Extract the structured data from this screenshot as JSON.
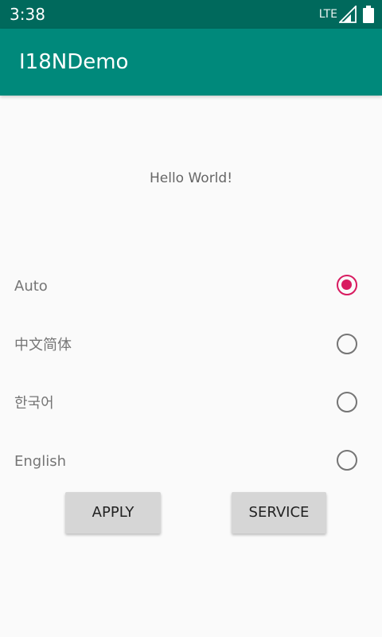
{
  "status_bar": {
    "time": "3:38",
    "network": "LTE",
    "icons": [
      "signal-icon",
      "battery-icon"
    ]
  },
  "app_bar": {
    "title": "I18NDemo",
    "color": "#00897b"
  },
  "main": {
    "greeting": "Hello World!"
  },
  "languages": [
    {
      "label": "Auto",
      "selected": true
    },
    {
      "label": "中文简体",
      "selected": false
    },
    {
      "label": "한국어",
      "selected": false
    },
    {
      "label": "English",
      "selected": false
    }
  ],
  "buttons": {
    "apply_label": "APPLY",
    "service_label": "SERVICE"
  },
  "colors": {
    "primary": "#00897b",
    "primary_dark": "#00695c",
    "accent": "#d81b60"
  }
}
